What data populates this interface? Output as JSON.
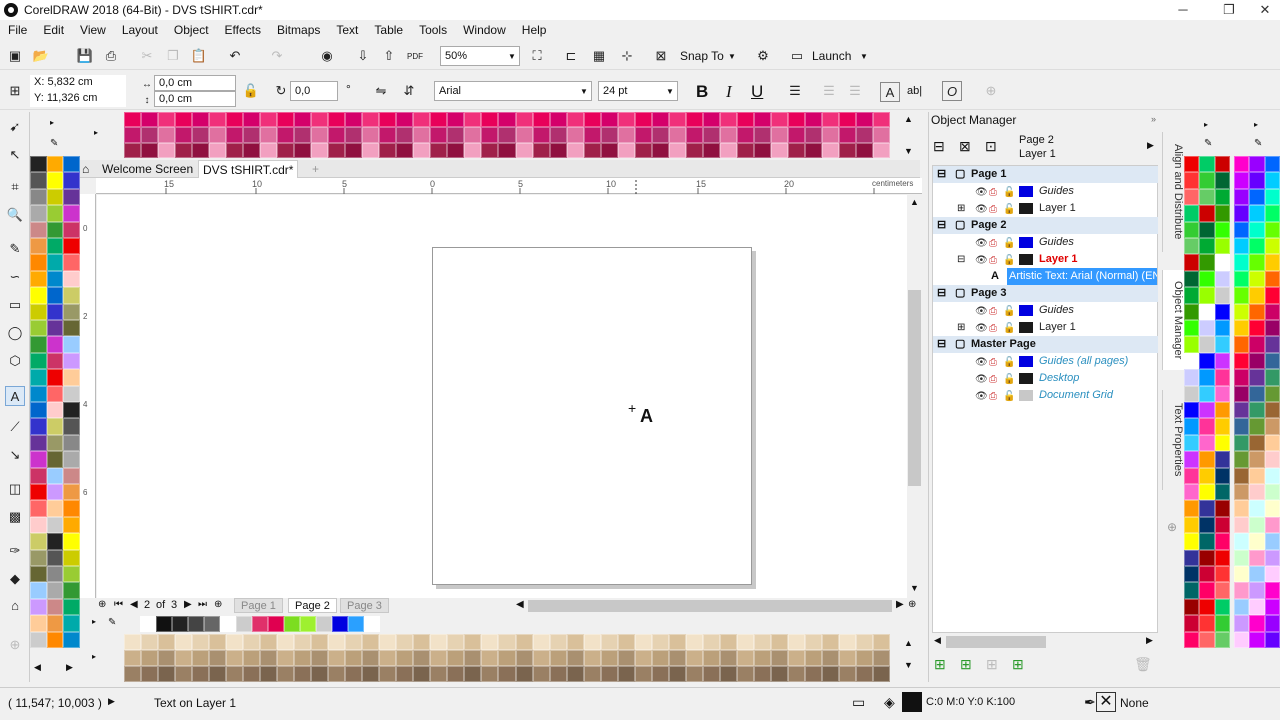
{
  "window": {
    "title": "CorelDRAW 2018 (64-Bit) - DVS tSHIRT.cdr*",
    "min_glyph": "─",
    "restore_glyph": "❐",
    "close_glyph": "✕"
  },
  "menu": [
    "File",
    "Edit",
    "View",
    "Layout",
    "Object",
    "Effects",
    "Bitmaps",
    "Text",
    "Table",
    "Tools",
    "Window",
    "Help"
  ],
  "standard_toolbar": {
    "zoom": "50%",
    "snap_to": "Snap To",
    "launch": "Launch",
    "pdf_label": "PDF"
  },
  "property_bar": {
    "x": "X: 5,832 cm",
    "y": "Y: 11,326 cm",
    "w": "0,0 cm",
    "h": "0,0 cm",
    "angle": "0,0",
    "degree": "°",
    "font": "Arial",
    "size": "24 pt",
    "bold": "B",
    "italic": "I",
    "underline": "U",
    "ab_label": "ab|"
  },
  "doc_tabs": {
    "welcome": "Welcome Screen",
    "file": "DVS tSHIRT.cdr*",
    "add": "+"
  },
  "ruler": {
    "labels": [
      "15",
      "10",
      "5",
      "0",
      "5",
      "10",
      "15",
      "20"
    ],
    "unit": "centimeters",
    "v_labels": [
      "0",
      "2",
      "4",
      "6"
    ]
  },
  "page_nav": {
    "current": "2",
    "of": "of",
    "total": "3",
    "tabs": [
      "Page 1",
      "Page 2",
      "Page 3"
    ]
  },
  "object_manager": {
    "title": "Object Manager",
    "current_page": "Page 2",
    "current_layer": "Layer 1",
    "rows": [
      {
        "kind": "page",
        "label": "Page 1"
      },
      {
        "kind": "layer",
        "label": "Guides",
        "italic": true,
        "swatch": "#0000e0",
        "color": "#222"
      },
      {
        "kind": "layer",
        "label": "Layer 1",
        "expander": "+",
        "swatch": "#1a1a1a",
        "color": "#222"
      },
      {
        "kind": "page",
        "label": "Page 2"
      },
      {
        "kind": "layer",
        "label": "Guides",
        "italic": true,
        "swatch": "#0000e0",
        "color": "#222"
      },
      {
        "kind": "layer",
        "label": "Layer 1",
        "expander": "−",
        "swatch": "#1a1a1a",
        "color": "#e00000"
      },
      {
        "kind": "object",
        "label": "Artistic Text: Arial (Normal) (EN"
      },
      {
        "kind": "page",
        "label": "Page 3"
      },
      {
        "kind": "layer",
        "label": "Guides",
        "italic": true,
        "swatch": "#0000e0",
        "color": "#222"
      },
      {
        "kind": "layer",
        "label": "Layer 1",
        "expander": "+",
        "swatch": "#1a1a1a",
        "color": "#222"
      },
      {
        "kind": "page",
        "label": "Master Page"
      },
      {
        "kind": "layer",
        "label": "Guides (all pages)",
        "italic": true,
        "swatch": "#0000e0",
        "color": "#2a8fbf"
      },
      {
        "kind": "layer",
        "label": "Desktop",
        "italic": true,
        "swatch": "#1a1a1a",
        "color": "#2a8fbf"
      },
      {
        "kind": "layer",
        "label": "Document Grid",
        "italic": true,
        "swatch": "#c8c8c8",
        "color": "#2a8fbf"
      }
    ]
  },
  "vertical_tabs": [
    "Align and Distribute",
    "Object Manager",
    "Text Properties"
  ],
  "status": {
    "coords": "( 11,547; 10,003 )",
    "message": "Text on Layer 1",
    "fill": "C:0 M:0 Y:0 K:100",
    "outline": "None"
  },
  "colors": {
    "accent_selection": "#3399ff",
    "page_row": "#dde8f4",
    "active_layer": "#e00000"
  }
}
